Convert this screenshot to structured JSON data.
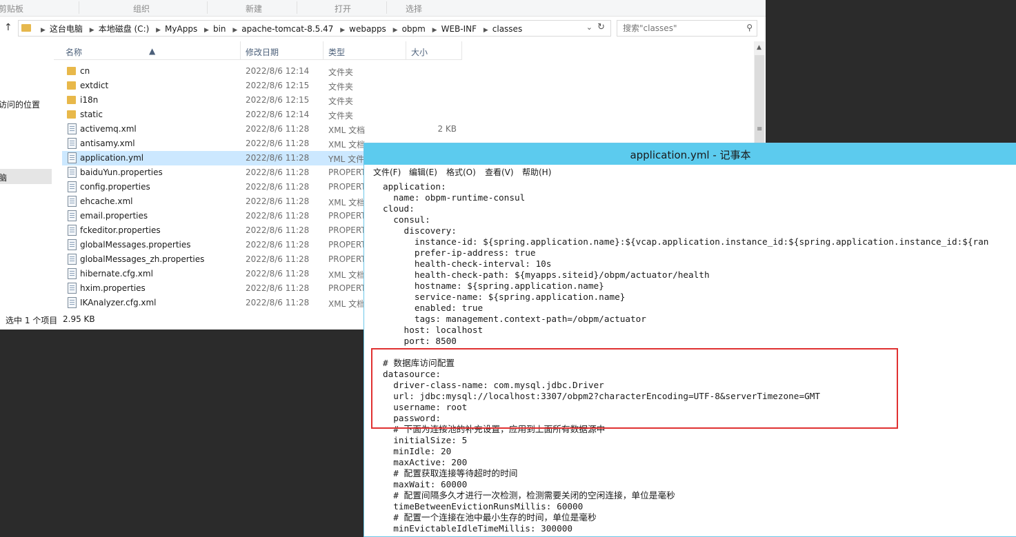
{
  "ribbon": {
    "groups": [
      "剪贴板",
      "组织",
      "新建",
      "打开",
      "选择"
    ]
  },
  "address": {
    "crumbs": [
      "这台电脑",
      "本地磁盘 (C:)",
      "MyApps",
      "bin",
      "apache-tomcat-8.5.47",
      "webapps",
      "obpm",
      "WEB-INF",
      "classes"
    ]
  },
  "search": {
    "placeholder": "搜索\"classes\""
  },
  "navpane": {
    "recent": "访问的位置",
    "selected": "脑"
  },
  "columns": {
    "name": "名称",
    "date": "修改日期",
    "type": "类型",
    "size": "大小"
  },
  "files": [
    {
      "name": "cn",
      "date": "2022/8/6 12:14",
      "type": "文件夹",
      "size": "",
      "kind": "folder"
    },
    {
      "name": "extdict",
      "date": "2022/8/6 12:15",
      "type": "文件夹",
      "size": "",
      "kind": "folder"
    },
    {
      "name": "i18n",
      "date": "2022/8/6 12:15",
      "type": "文件夹",
      "size": "",
      "kind": "folder"
    },
    {
      "name": "static",
      "date": "2022/8/6 12:14",
      "type": "文件夹",
      "size": "",
      "kind": "folder"
    },
    {
      "name": "activemq.xml",
      "date": "2022/8/6 11:28",
      "type": "XML 文档",
      "size": "2 KB",
      "kind": "file"
    },
    {
      "name": "antisamy.xml",
      "date": "2022/8/6 11:28",
      "type": "XML 文档",
      "size": "",
      "kind": "file"
    },
    {
      "name": "application.yml",
      "date": "2022/8/6 11:28",
      "type": "YML 文件",
      "size": "",
      "kind": "file"
    },
    {
      "name": "baiduYun.properties",
      "date": "2022/8/6 11:28",
      "type": "PROPERT",
      "size": "",
      "kind": "file"
    },
    {
      "name": "config.properties",
      "date": "2022/8/6 11:28",
      "type": "PROPERT",
      "size": "",
      "kind": "file"
    },
    {
      "name": "ehcache.xml",
      "date": "2022/8/6 11:28",
      "type": "XML 文档",
      "size": "",
      "kind": "file"
    },
    {
      "name": "email.properties",
      "date": "2022/8/6 11:28",
      "type": "PROPERT",
      "size": "",
      "kind": "file"
    },
    {
      "name": "fckeditor.properties",
      "date": "2022/8/6 11:28",
      "type": "PROPERT",
      "size": "",
      "kind": "file"
    },
    {
      "name": "globalMessages.properties",
      "date": "2022/8/6 11:28",
      "type": "PROPERT",
      "size": "",
      "kind": "file"
    },
    {
      "name": "globalMessages_zh.properties",
      "date": "2022/8/6 11:28",
      "type": "PROPERT",
      "size": "",
      "kind": "file"
    },
    {
      "name": "hibernate.cfg.xml",
      "date": "2022/8/6 11:28",
      "type": "XML 文档",
      "size": "",
      "kind": "file"
    },
    {
      "name": "hxim.properties",
      "date": "2022/8/6 11:28",
      "type": "PROPERT",
      "size": "",
      "kind": "file"
    },
    {
      "name": "IKAnalyzer.cfg.xml",
      "date": "2022/8/6 11:28",
      "type": "XML 文档",
      "size": "",
      "kind": "file"
    }
  ],
  "selected_index": 6,
  "status": {
    "selection": "选中 1 个项目",
    "size": "2.95 KB"
  },
  "notepad": {
    "title": "application.yml - 记事本",
    "menu": [
      "文件(F)",
      "编辑(E)",
      "格式(O)",
      "查看(V)",
      "帮助(H)"
    ],
    "lines": [
      "application:",
      "  name: obpm-runtime-consul",
      "cloud:",
      "  consul:",
      "    discovery:",
      "      instance-id: ${spring.application.name}:${vcap.application.instance_id:${spring.application.instance_id:${ran",
      "      prefer-ip-address: true",
      "      health-check-interval: 10s",
      "      health-check-path: ${myapps.siteid}/obpm/actuator/health",
      "      hostname: ${spring.application.name}",
      "      service-name: ${spring.application.name}",
      "      enabled: true",
      "      tags: management.context-path=/obpm/actuator",
      "    host: localhost",
      "    port: 8500",
      "",
      "# 数据库访问配置",
      "datasource:",
      "  driver-class-name: com.mysql.jdbc.Driver",
      "  url: jdbc:mysql://localhost:3307/obpm2?characterEncoding=UTF-8&serverTimezone=GMT",
      "  username: root",
      "  password:",
      "  # 下面为连接池的补充设置，应用到上面所有数据源中",
      "  initialSize: 5",
      "  minIdle: 20",
      "  maxActive: 200",
      "  # 配置获取连接等待超时的时间",
      "  maxWait: 60000",
      "  # 配置间隔多久才进行一次检测，检测需要关闭的空闲连接，单位是毫秒",
      "  timeBetweenEvictionRunsMillis: 60000",
      "  # 配置一个连接在池中最小生存的时间，单位是毫秒",
      "  minEvictableIdleTimeMillis: 300000"
    ]
  },
  "colors": {
    "notepad_title": "#5ccbee",
    "selection": "#cce8ff",
    "highlight_box": "#e03030"
  }
}
